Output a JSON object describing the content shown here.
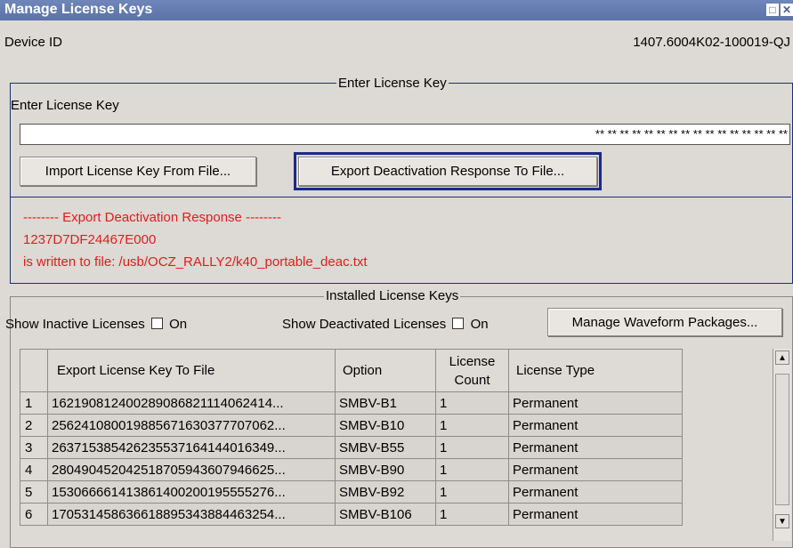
{
  "window": {
    "title": "Manage License Keys"
  },
  "device": {
    "label": "Device ID",
    "value": "1407.6004K02-100019-QJ"
  },
  "enter_panel": {
    "legend": "Enter License Key",
    "field_label": "Enter License Key",
    "field_value": "** ** ** ** ** ** ** ** ** ** ** ** ** ** ** **",
    "import_button": "Import License Key From File...",
    "export_button": "Export Deactivation Response To File...",
    "message": [
      "-------- Export Deactivation Response --------",
      "1237D7DF24467E000",
      "is written to file: /usb/OCZ_RALLY2/k40_portable_deac.txt"
    ]
  },
  "installed_panel": {
    "legend": "Installed License Keys",
    "show_inactive_label": "Show Inactive Licenses",
    "show_deactivated_label": "Show Deactivated Licenses",
    "on_label": "On",
    "show_inactive_checked": false,
    "show_deactivated_checked": false,
    "manage_button": "Manage Waveform Packages..."
  },
  "table": {
    "headers": [
      "",
      "Export License Key To File",
      "Option",
      "License Count",
      "License Type"
    ],
    "rows": [
      [
        "1",
        "162190812400289086821114062414...",
        "SMBV-B1",
        "1",
        "Permanent"
      ],
      [
        "2",
        "256241080019885671630377707062...",
        "SMBV-B10",
        "1",
        "Permanent"
      ],
      [
        "3",
        "263715385426235537164144016349...",
        "SMBV-B55",
        "1",
        "Permanent"
      ],
      [
        "4",
        "280490452042518705943607946625...",
        "SMBV-B90",
        "1",
        "Permanent"
      ],
      [
        "5",
        "153066661413861400200195555276...",
        "SMBV-B92",
        "1",
        "Permanent"
      ],
      [
        "6",
        "170531458636618895343884463254...",
        "SMBV-B106",
        "1",
        "Permanent"
      ]
    ]
  },
  "colors": {
    "accent": "#1a2a8c",
    "message": "#e21c1c",
    "titlebar": "#5c72a6"
  }
}
